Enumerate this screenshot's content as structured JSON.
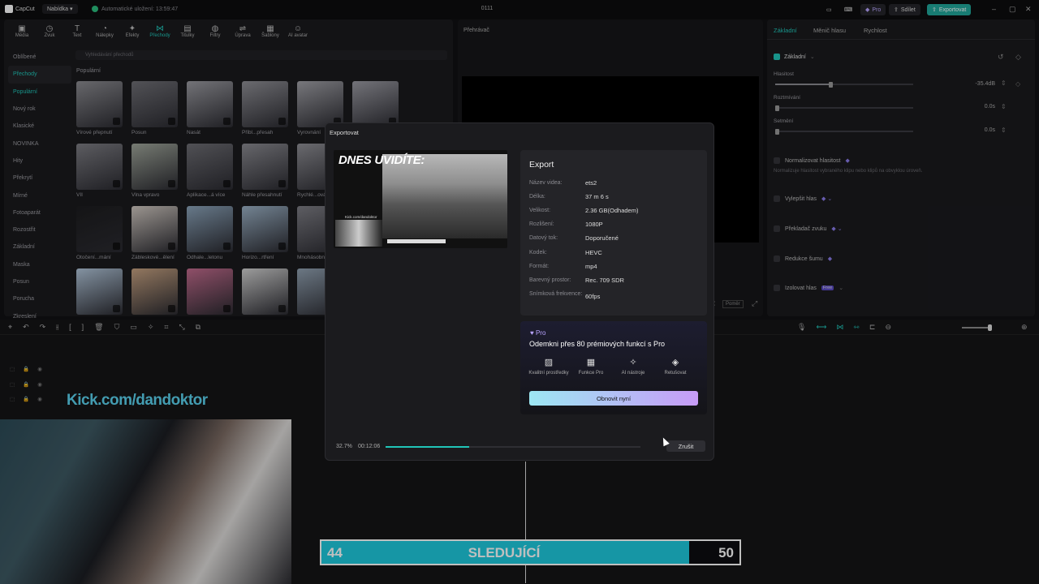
{
  "titlebar": {
    "app_name": "CapCut",
    "menu_label": "Nabídka",
    "autosave": "Automatické uložení: 13:59:47",
    "project_title": "0111",
    "pro_label": "Pro",
    "share_label": "Sdílet",
    "export_label": "Exportovat"
  },
  "toolbar": [
    {
      "label": "Média",
      "icon": "media-icon",
      "glyph": "▣"
    },
    {
      "label": "Zvuk",
      "icon": "audio-icon",
      "glyph": "◷"
    },
    {
      "label": "Text",
      "icon": "text-icon",
      "glyph": "T"
    },
    {
      "label": "Nálepky",
      "icon": "sticker-icon",
      "glyph": "◔"
    },
    {
      "label": "Efekty",
      "icon": "effects-icon",
      "glyph": "✦"
    },
    {
      "label": "Přechody",
      "icon": "transitions-icon",
      "glyph": "⋈"
    },
    {
      "label": "Titulky",
      "icon": "captions-icon",
      "glyph": "▤"
    },
    {
      "label": "Filtry",
      "icon": "filters-icon",
      "glyph": "◍"
    },
    {
      "label": "Úprava",
      "icon": "adjust-icon",
      "glyph": "⇌"
    },
    {
      "label": "Šablony",
      "icon": "templates-icon",
      "glyph": "▦"
    },
    {
      "label": "AI avatar",
      "icon": "ai-avatar-icon",
      "glyph": "☺"
    }
  ],
  "sidebar": [
    {
      "label": "Oblíbené"
    },
    {
      "label": "Přechody"
    },
    {
      "label": "Populární"
    },
    {
      "label": "Nový rok"
    },
    {
      "label": "Klasické"
    },
    {
      "label": "NOVINKA"
    },
    {
      "label": "Hity"
    },
    {
      "label": "Překrytí"
    },
    {
      "label": "Mírné"
    },
    {
      "label": "Fotoaparát"
    },
    {
      "label": "Rozostřit"
    },
    {
      "label": "Základní"
    },
    {
      "label": "Maska"
    },
    {
      "label": "Posun"
    },
    {
      "label": "Porucha"
    },
    {
      "label": "Zkreslení"
    }
  ],
  "search_placeholder": "Vyhledávání přechodů",
  "section_label": "Populární",
  "thumbs": [
    [
      "Vírové přepnutí",
      "Posun",
      "Nasát",
      "Přibl...přesah",
      "Vyrovnání",
      ""
    ],
    [
      "VII",
      "Vlna vpravo",
      "Aplikace...á více",
      "Náhle přesahnutí",
      "Rychlé...ování",
      ""
    ],
    [
      "Otočení...mání",
      "Zábleskové...ělení",
      "Odhale...letonu",
      "Horizo...rtření",
      "Mnohásobné",
      ""
    ],
    [
      "",
      "",
      "",
      "",
      "",
      ""
    ]
  ],
  "player": {
    "label": "Přehrávač",
    "fit_label": "Poměr"
  },
  "right": {
    "tabs": [
      "Základní",
      "Měnič hlasu",
      "Rychlost"
    ],
    "basic_label": "Základní",
    "volume_label": "Hlasitost",
    "volume_value": "-35.4dB",
    "volume_level": 0.4,
    "fadein_label": "Roztmívání",
    "fadein_value": "0.0s",
    "fadeout_label": "Setmění",
    "fadeout_value": "0.0s",
    "normalize_label": "Normalizovat hlasitost",
    "normalize_desc": "Normalizuje hlasitost vybraného klipu nebo klipů na obvyklou úroveň.",
    "enhance_label": "Vylepšit hlas",
    "translator_label": "Překladač zvuku",
    "noise_label": "Redukce šumu",
    "isolate_label": "Izolovat hlas",
    "isolate_badge": "Free"
  },
  "modal": {
    "title": "Exportovat",
    "preview_text": "DNES UVIDÍTE:",
    "preview_small": "Kick.com/dandoktor",
    "section_title": "Export",
    "rows": [
      {
        "label": "Název videa:",
        "value": "ets2"
      },
      {
        "label": "Délka:",
        "value": "37 m 6 s"
      },
      {
        "label": "Velikost:",
        "value": "2.36 GB(Odhadem)"
      },
      {
        "label": "Rozlišení:",
        "value": "1080P"
      },
      {
        "label": "Datový tok:",
        "value": "Doporučené"
      },
      {
        "label": "Kodek:",
        "value": "HEVC"
      },
      {
        "label": "Formát:",
        "value": "mp4"
      },
      {
        "label": "Barevný prostor:",
        "value": "Rec. 709 SDR"
      },
      {
        "label": "Snímková frekvence:",
        "value": "60fps"
      }
    ],
    "pro_badge": "♥ Pro",
    "pro_text": "Odemkni přes 80 prémiových funkcí s Pro",
    "pro_features": [
      {
        "label": "Kvalitní prostředky",
        "icon": "image-icon",
        "glyph": "▨"
      },
      {
        "label": "Funkce Pro",
        "icon": "grid-icon",
        "glyph": "▦"
      },
      {
        "label": "AI nástroje",
        "icon": "magic-wand-icon",
        "glyph": "✧"
      },
      {
        "label": "Retušovat",
        "icon": "retouch-icon",
        "glyph": "◈"
      }
    ],
    "renew_label": "Obnovit nyní",
    "progress_percent": "32.7%",
    "progress_fraction": 0.327,
    "progress_time": "00:12:06",
    "cancel_label": "Zrušit"
  },
  "overlay": {
    "kick_text": "Kick.com/dandoktor",
    "followers_current": "44",
    "followers_label": "SLEDUJÍCÍ",
    "followers_goal": "50",
    "followers_fraction": 0.88
  },
  "colors": {
    "accent": "#20c5b8",
    "follow_bar": "#1ec8dd",
    "pro": "#b9a4ff"
  }
}
